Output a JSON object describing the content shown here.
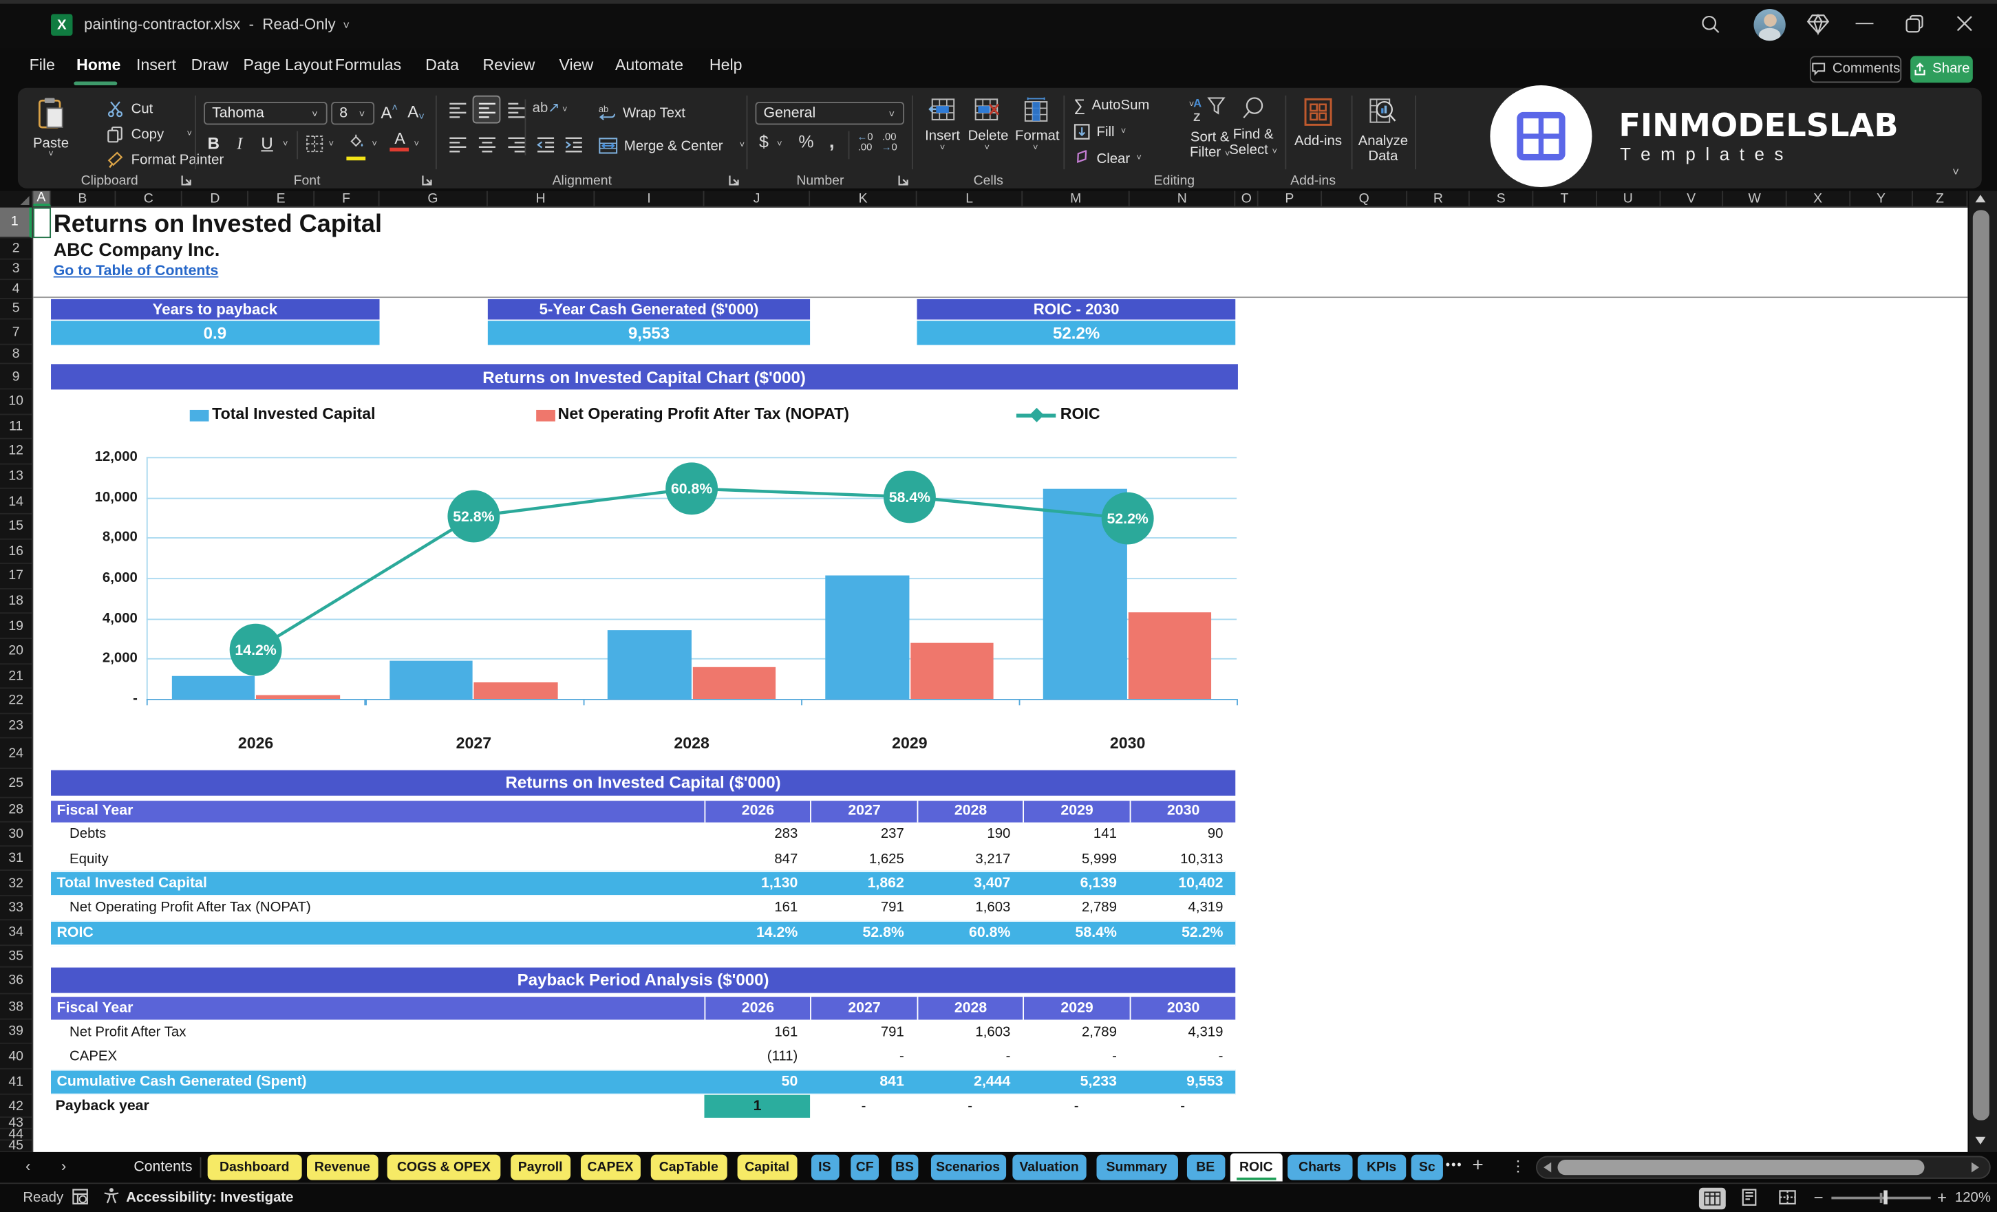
{
  "window": {
    "file": "painting-contractor.xlsx",
    "sep": "-",
    "mode": "Read-Only"
  },
  "menu": {
    "items": [
      "File",
      "Home",
      "Insert",
      "Draw",
      "Page Layout",
      "Formulas",
      "Data",
      "Review",
      "View",
      "Automate",
      "Help"
    ],
    "active_index": 1,
    "comments": "Comments",
    "share": "Share"
  },
  "ribbon": {
    "clipboard": {
      "label": "Clipboard",
      "paste": "Paste",
      "cut": "Cut",
      "copy": "Copy",
      "format_painter": "Format Painter"
    },
    "font": {
      "label": "Font",
      "family": "Tahoma",
      "size": "8"
    },
    "alignment": {
      "label": "Alignment",
      "wrap": "Wrap Text",
      "merge": "Merge & Center"
    },
    "number": {
      "label": "Number",
      "format": "General"
    },
    "cells": {
      "label": "Cells",
      "insert": "Insert",
      "delete": "Delete",
      "format": "Format"
    },
    "editing": {
      "label": "Editing",
      "autosum": "AutoSum",
      "fill": "Fill",
      "clear": "Clear",
      "sort1": "Sort &",
      "sort2": "Filter",
      "find1": "Find &",
      "find2": "Select"
    },
    "addins": {
      "label": "Add-ins",
      "addins": "Add-ins",
      "analyze1": "Analyze",
      "analyze2": "Data"
    }
  },
  "logo": {
    "brand": "FINMODELSLAB",
    "sub": "T e m p l a t e s"
  },
  "grid": {
    "columns": [
      "A",
      "B",
      "C",
      "D",
      "E",
      "F",
      "G",
      "H",
      "I",
      "J",
      "K",
      "L",
      "M",
      "N",
      "O",
      "P",
      "Q",
      "R",
      "S",
      "T",
      "U",
      "V",
      "W",
      "X",
      "Y",
      "Z"
    ]
  },
  "doc": {
    "title": "Returns on Invested Capital",
    "company": "ABC Company Inc.",
    "link": "Go to Table of Contents"
  },
  "kpis": [
    {
      "label": "Years to payback",
      "value": "0.9"
    },
    {
      "label": "5-Year Cash Generated ($'000)",
      "value": "9,553"
    },
    {
      "label": "ROIC - 2030",
      "value": "52.2%"
    }
  ],
  "chart": {
    "title": "Returns on Invested Capital Chart ($'000)",
    "legend": [
      "Total Invested Capital",
      "Net Operating Profit After Tax (NOPAT)",
      "ROIC"
    ],
    "chart_data": {
      "type": "bar+line",
      "categories": [
        "2026",
        "2027",
        "2028",
        "2029",
        "2030"
      ],
      "series": [
        {
          "name": "Total Invested Capital",
          "type": "bar",
          "color": "#49afe4",
          "values": [
            1130,
            1862,
            3407,
            6139,
            10402
          ]
        },
        {
          "name": "Net Operating Profit After Tax (NOPAT)",
          "type": "bar",
          "color": "#ef776c",
          "values": [
            161,
            791,
            1603,
            2789,
            4319
          ]
        },
        {
          "name": "ROIC",
          "type": "line",
          "color": "#2ba99a",
          "values_pct": [
            14.2,
            52.8,
            60.8,
            58.4,
            52.2
          ],
          "labels": [
            "14.2%",
            "52.8%",
            "60.8%",
            "58.4%",
            "52.2%"
          ]
        }
      ],
      "ylim": [
        0,
        12000
      ],
      "y2lim": [
        0,
        70
      ],
      "yticks": [
        "12,000",
        "10,000",
        "8,000",
        "6,000",
        "4,000",
        "2,000",
        "-"
      ],
      "grid": true,
      "legend_position": "top"
    }
  },
  "table1": {
    "title": "Returns on Invested Capital ($'000)",
    "header": [
      "Fiscal Year",
      "2026",
      "2027",
      "2028",
      "2029",
      "2030"
    ],
    "rows": [
      {
        "label": "Debts",
        "style": "plain",
        "values": [
          "283",
          "237",
          "190",
          "141",
          "90"
        ]
      },
      {
        "label": "Equity",
        "style": "plain",
        "values": [
          "847",
          "1,625",
          "3,217",
          "5,999",
          "10,313"
        ]
      },
      {
        "label": "Total Invested Capital",
        "style": "highlight",
        "values": [
          "1,130",
          "1,862",
          "3,407",
          "6,139",
          "10,402"
        ]
      },
      {
        "label": "Net Operating Profit After Tax (NOPAT)",
        "style": "plain",
        "values": [
          "161",
          "791",
          "1,603",
          "2,789",
          "4,319"
        ]
      },
      {
        "label": "ROIC",
        "style": "highlight",
        "values": [
          "14.2%",
          "52.8%",
          "60.8%",
          "58.4%",
          "52.2%"
        ]
      }
    ]
  },
  "table2": {
    "title": "Payback Period Analysis ($'000)",
    "header": [
      "Fiscal Year",
      "2026",
      "2027",
      "2028",
      "2029",
      "2030"
    ],
    "rows": [
      {
        "label": "Net Profit After Tax",
        "style": "plain",
        "values": [
          "161",
          "791",
          "1,603",
          "2,789",
          "4,319"
        ]
      },
      {
        "label": "CAPEX",
        "style": "plain",
        "values": [
          "(111)",
          "-",
          "-",
          "-",
          "-"
        ]
      },
      {
        "label": "Cumulative Cash Generated (Spent)",
        "style": "highlight",
        "values": [
          "50",
          "841",
          "2,444",
          "5,233",
          "9,553"
        ]
      },
      {
        "label": "Payback year",
        "style": "payback",
        "values": [
          "1",
          "-",
          "-",
          "-",
          "-"
        ]
      }
    ]
  },
  "tabs": {
    "first": "Contents",
    "items": [
      {
        "label": "Dashboard",
        "color": "yellow"
      },
      {
        "label": "Revenue",
        "color": "yellow"
      },
      {
        "label": "COGS & OPEX",
        "color": "yellow"
      },
      {
        "label": "Payroll",
        "color": "yellow"
      },
      {
        "label": "CAPEX",
        "color": "yellow"
      },
      {
        "label": "CapTable",
        "color": "yellow"
      },
      {
        "label": "Capital",
        "color": "yellow"
      },
      {
        "label": "IS",
        "color": "blue"
      },
      {
        "label": "CF",
        "color": "blue"
      },
      {
        "label": "BS",
        "color": "blue"
      },
      {
        "label": "Scenarios",
        "color": "blue"
      },
      {
        "label": "Valuation",
        "color": "blue"
      },
      {
        "label": "Summary",
        "color": "blue"
      },
      {
        "label": "BE",
        "color": "blue"
      },
      {
        "label": "ROIC",
        "color": "active"
      },
      {
        "label": "Charts",
        "color": "blue"
      },
      {
        "label": "KPIs",
        "color": "blue"
      },
      {
        "label": "Sc",
        "color": "blue"
      }
    ]
  },
  "status": {
    "ready": "Ready",
    "accessibility": "Accessibility: Investigate",
    "zoom": "120%"
  }
}
